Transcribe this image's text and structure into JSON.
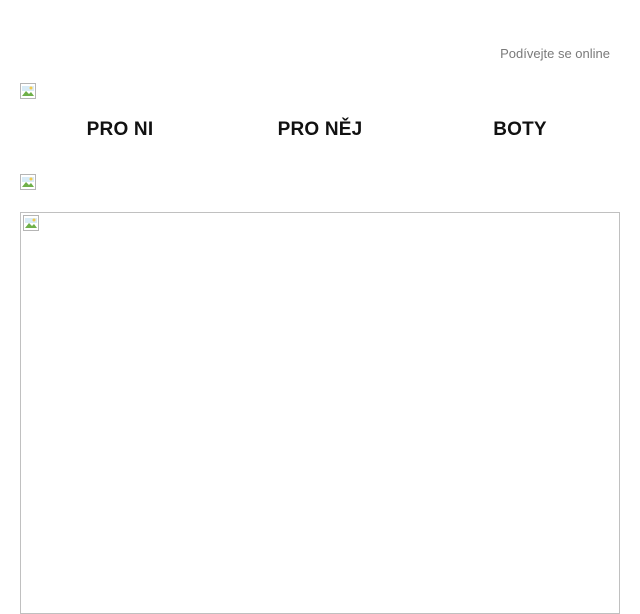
{
  "header": {
    "online_link": "Podívejte se online"
  },
  "nav": {
    "items": [
      {
        "label": "PRO NI"
      },
      {
        "label": "PRO NĚJ"
      },
      {
        "label": "BOTY"
      }
    ]
  },
  "images": {
    "logo_icon": "broken-image-icon",
    "banner_icon": "broken-image-icon",
    "hero_icon": "broken-image-icon"
  },
  "colors": {
    "link_gray": "#7a7a7a",
    "nav_text": "#111111",
    "hero_border": "#c0c0c0"
  }
}
